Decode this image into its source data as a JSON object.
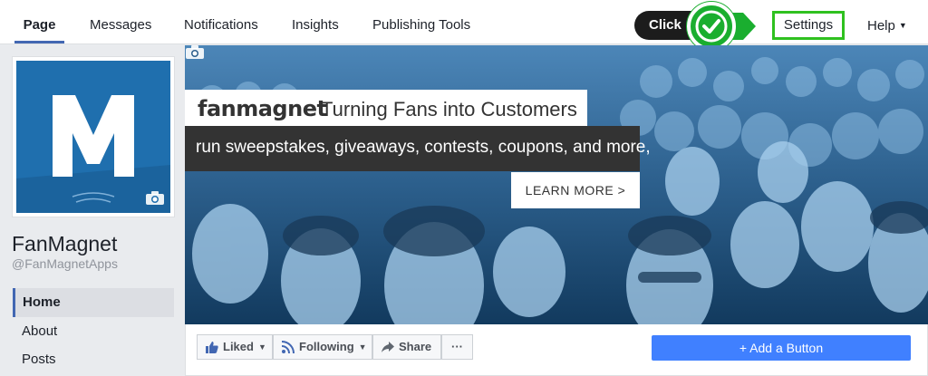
{
  "nav": {
    "tabs": [
      {
        "label": "Page"
      },
      {
        "label": "Messages"
      },
      {
        "label": "Notifications"
      },
      {
        "label": "Insights"
      },
      {
        "label": "Publishing Tools"
      }
    ],
    "settings_label": "Settings",
    "help_label": "Help"
  },
  "annotation": {
    "click_label": "Click",
    "accent": "#2fc11f"
  },
  "page": {
    "name": "FanMagnet",
    "handle": "@FanMagnetApps",
    "logo_letter": "M"
  },
  "left_nav": {
    "items": [
      {
        "label": "Home"
      },
      {
        "label": "About"
      },
      {
        "label": "Posts"
      }
    ]
  },
  "cover": {
    "brand": "fanmagnet",
    "tagline": "Turning Fans into Customers",
    "subline": "run sweepstakes, giveaways, contests, coupons, and more,",
    "cta": "LEARN MORE >"
  },
  "actions": {
    "liked": "Liked",
    "following": "Following",
    "share": "Share",
    "more": "···",
    "add_button": "+ Add a Button"
  },
  "colors": {
    "brand_blue": "#4267b2",
    "cta_blue": "#4080ff",
    "logo_bg": "#1f6fae"
  }
}
